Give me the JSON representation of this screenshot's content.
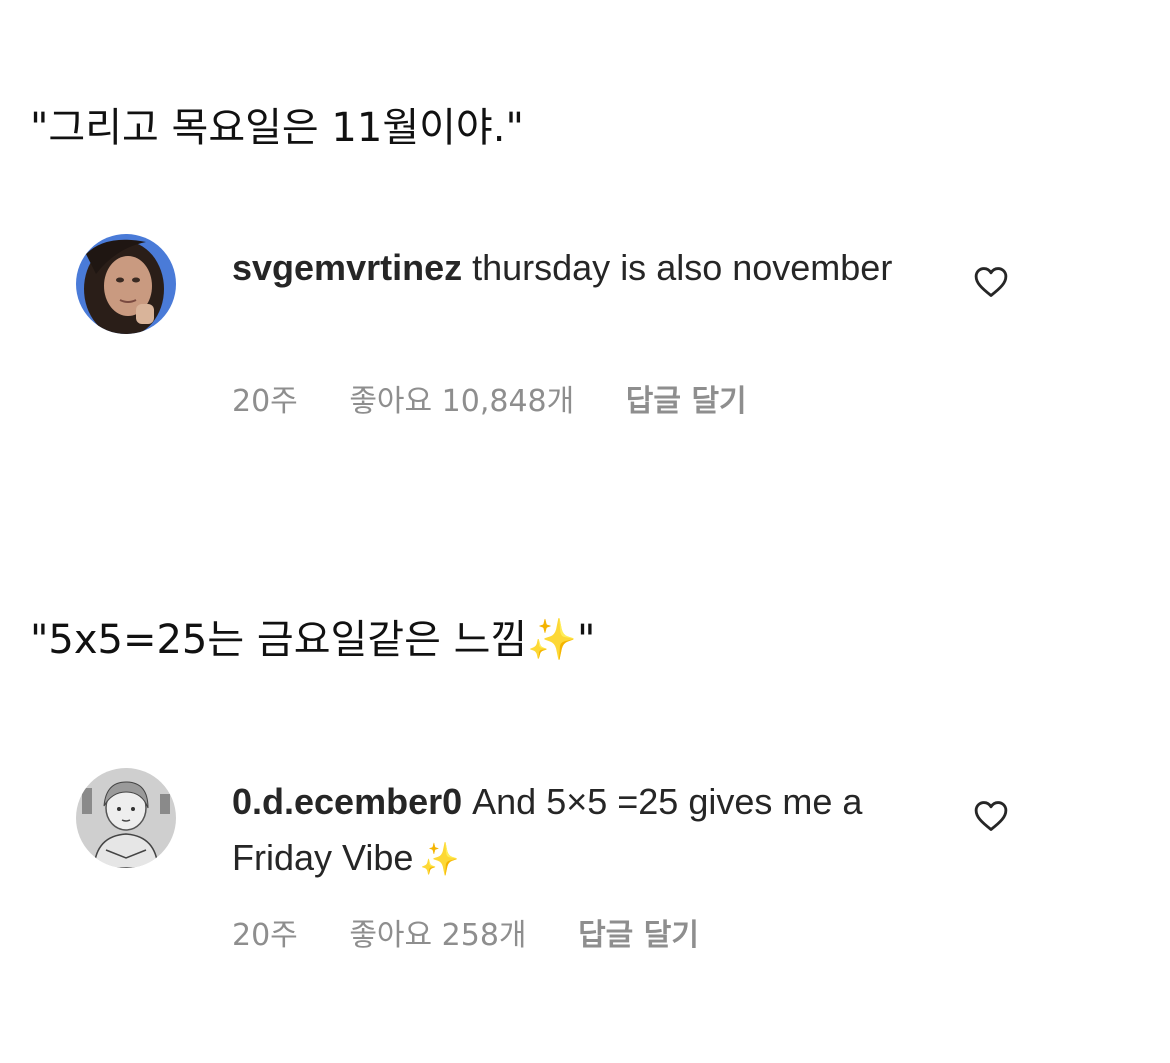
{
  "captions": [
    "\"그리고 목요일은 11월이야.\"",
    "\"5x5=25는 금요일같은 느낌✨\""
  ],
  "comments": [
    {
      "username": "svgemvrtinez",
      "text": "thursday is also november",
      "sparkle": "",
      "time": "20주",
      "likes": "좋아요 10,848개",
      "reply": "답글 달기",
      "avatar_icon": "profile-photo",
      "like_icon": "heart-outline-icon"
    },
    {
      "username": "0.d.ecember0",
      "text": "And 5×5 =25 gives me a Friday Vibe",
      "sparkle": "✨",
      "time": "20주",
      "likes": "좋아요 258개",
      "reply": "답글 달기",
      "avatar_icon": "profile-drawing",
      "like_icon": "heart-outline-icon"
    }
  ],
  "colors": {
    "text": "#262626",
    "meta": "#8e8e8e",
    "sparkle": "#f2c94c"
  }
}
